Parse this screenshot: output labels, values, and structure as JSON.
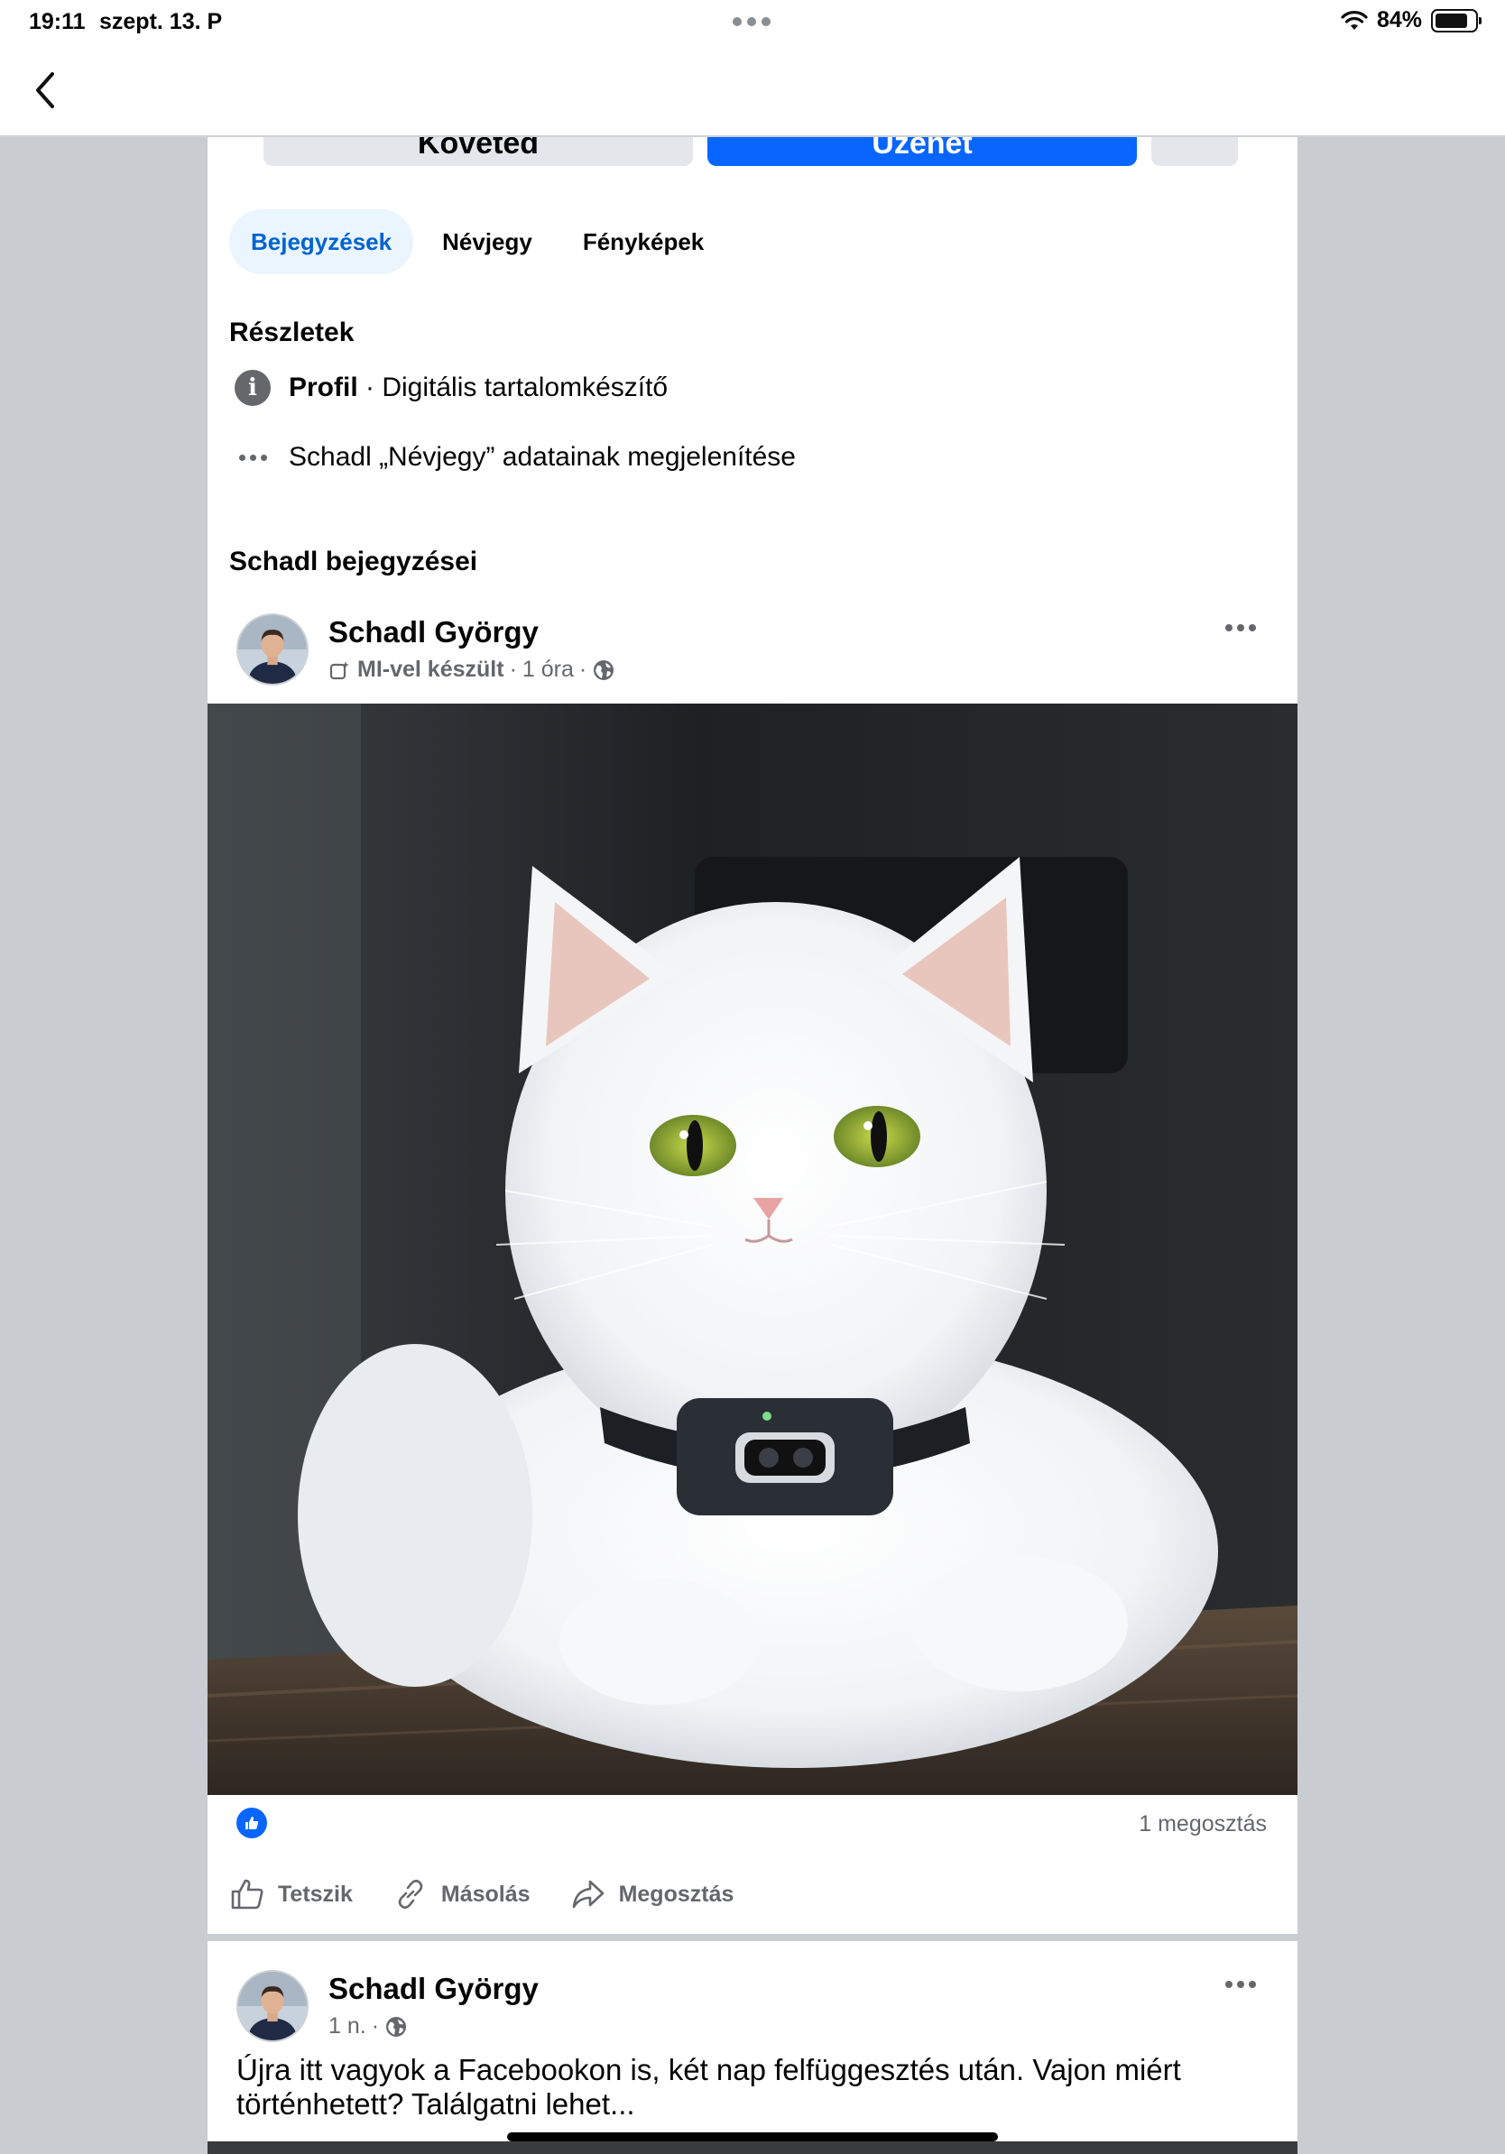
{
  "status_bar": {
    "time": "19:11",
    "date": "szept. 13. P",
    "battery": "84%"
  },
  "profile_buttons": {
    "follow_label": "Követed",
    "message_label": "Üzenet"
  },
  "tabs": [
    {
      "label": "Bejegyzések",
      "active": true
    },
    {
      "label": "Névjegy",
      "active": false
    },
    {
      "label": "Fényképek",
      "active": false
    }
  ],
  "details": {
    "heading": "Részletek",
    "profile_bold": "Profil",
    "profile_rest": " · Digitális tartalomkészítő",
    "about_link": "Schadl „Névjegy” adatainak megjelenítése"
  },
  "posts_heading": "Schadl bejegyzései",
  "post1": {
    "author": "Schadl György",
    "ai_label": "MI-vel készült",
    "time": "1 óra",
    "shares": "1 megosztás",
    "actions": {
      "like": "Tetszik",
      "copy": "Másolás",
      "share": "Megosztás"
    }
  },
  "post2": {
    "author": "Schadl György",
    "time": "1 n.",
    "text": "Újra itt vagyok a Facebookon is, két nap felfüggesztés után. Vajon miért történhetett? Találgatni lehet..."
  },
  "colors": {
    "accent": "#0866ff",
    "tab_active_bg": "#ebf5ff",
    "tab_active_text": "#0064d1",
    "page_bg": "#c9ccd1"
  },
  "icons": [
    "back-chevron-icon",
    "wifi-icon",
    "battery-icon",
    "info-icon",
    "more-dots-icon",
    "globe-icon",
    "ai-label-icon",
    "like-reaction-icon",
    "thumbs-up-icon",
    "link-icon",
    "share-icon"
  ]
}
